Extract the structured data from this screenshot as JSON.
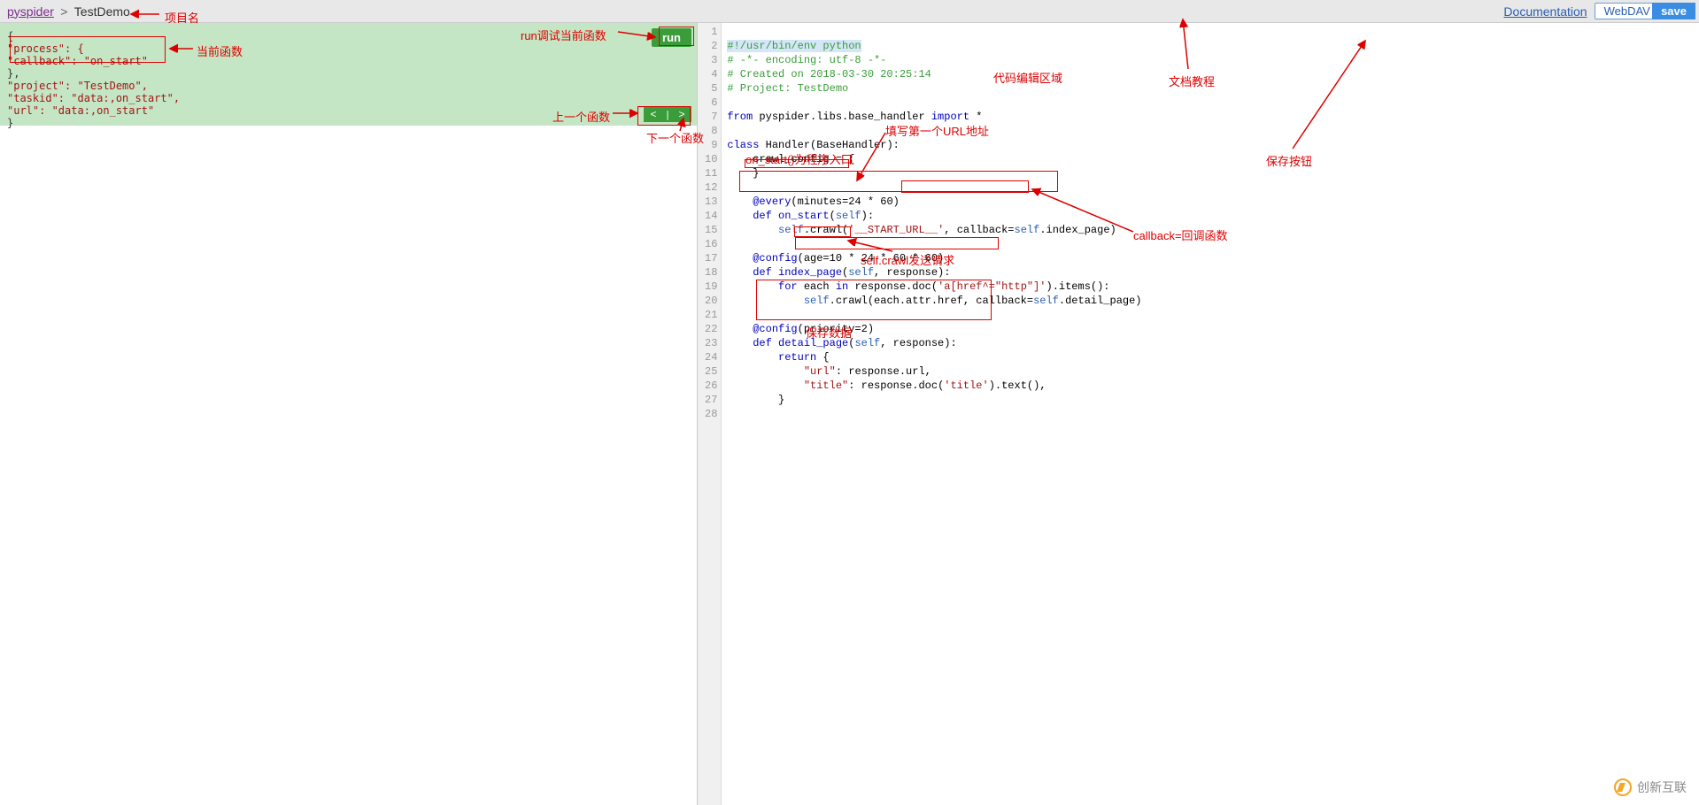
{
  "breadcrumb": {
    "root": "pyspider",
    "sep": ">",
    "project": "TestDemo"
  },
  "toolbar": {
    "doc": "Documentation",
    "webdav": "WebDAV Mode",
    "run": "run",
    "save": "save",
    "prev": "<",
    "divider": "|",
    "next": ">"
  },
  "taskPanel": {
    "l1": "{",
    "l2": "  \"process\": {",
    "l3": "    \"callback\": \"on_start\"",
    "l4": "  },",
    "l5": "  \"project\": \"TestDemo\",",
    "l6": "  \"taskid\": \"data:,on_start\",",
    "l7": "  \"url\": \"data:,on_start\"",
    "l8": "}"
  },
  "gutter": [
    "1",
    "2",
    "3",
    "4",
    "5",
    "6",
    "7",
    "8",
    "9",
    "10",
    "11",
    "12",
    "13",
    "14",
    "15",
    "16",
    "17",
    "18",
    "19",
    "20",
    "21",
    "22",
    "23",
    "24",
    "25",
    "26",
    "27",
    "28"
  ],
  "code": {
    "l1a": "#!/usr/bin/env python",
    "l2a": "# -*- encoding: utf-8 -*-",
    "l3a": "# Created on 2018-03-30 20:25:14",
    "l4a": "# Project: TestDemo",
    "l6_from": "from",
    "l6_mod": " pyspider.libs.base_handler ",
    "l6_imp": "import",
    "l6_star": " *",
    "l8_cls": "class",
    "l8_name": " Handler",
    "l8_base": "(BaseHandler):",
    "l9": "    crawl_config = {",
    "l10": "    }",
    "l12": "    @every",
    "l12b": "(minutes=24 * 60)",
    "l13_def": "    def ",
    "l13_name": "on_start",
    "l13_sig": "(",
    "l13_self": "self",
    "l13_sig2": "):",
    "l14_ind": "        ",
    "l14_self": "self",
    "l14_crawl": ".crawl(",
    "l14_url": "'__START_URL__'",
    "l14_comma": ", ",
    "l14_cb": "callback=",
    "l14_self2": "self",
    "l14_ip": ".index_page)",
    "l16": "    @config",
    "l16b": "(age=10 * 24 * 60 * 60)",
    "l17_def": "    def ",
    "l17_name": "index_page",
    "l17_sig": "(",
    "l17_self": "self",
    "l17_sig2": ", response):",
    "l18_ind": "        ",
    "l18_for": "for",
    "l18_each": " each ",
    "l18_in": "in",
    "l18_rest": " response.doc(",
    "l18_sel": "'a[href^=\"http\"]'",
    "l18_rest2": ").items():",
    "l19_ind": "            ",
    "l19_self": "self",
    "l19_rest": ".crawl(each.attr.href, callback=",
    "l19_self2": "self",
    "l19_rest2": ".detail_page)",
    "l21": "    @config",
    "l21b": "(priority=2)",
    "l22_def": "    def ",
    "l22_name": "detail_page",
    "l22_sig": "(",
    "l22_self": "self",
    "l22_sig2": ", response):",
    "l23_ind": "        ",
    "l23_ret": "return",
    "l23_brace": " {",
    "l24_ind": "            ",
    "l24_k": "\"url\"",
    "l24_v": ": response.url,",
    "l25_ind": "            ",
    "l25_k": "\"title\"",
    "l25_v": ": response.doc(",
    "l25_s": "'title'",
    "l25_v2": ").text(),",
    "l26": "        }"
  },
  "annotations": {
    "projName": "项目名",
    "curFunc": "当前函数",
    "runDebug": "run调试当前函数",
    "prevFunc": "上一个函数",
    "nextFunc": "下一个函数",
    "codeArea": "代码编辑区域",
    "docTut": "文档教程",
    "saveBtn": "保存按钮",
    "firstUrl": "填写第一个URL地址",
    "onstart": "on_start()为程序入口",
    "callback": "callback=回调函数",
    "crawlSend": "self.crawl发送请求",
    "saveData": "保存数据"
  },
  "logo": "创新互联"
}
